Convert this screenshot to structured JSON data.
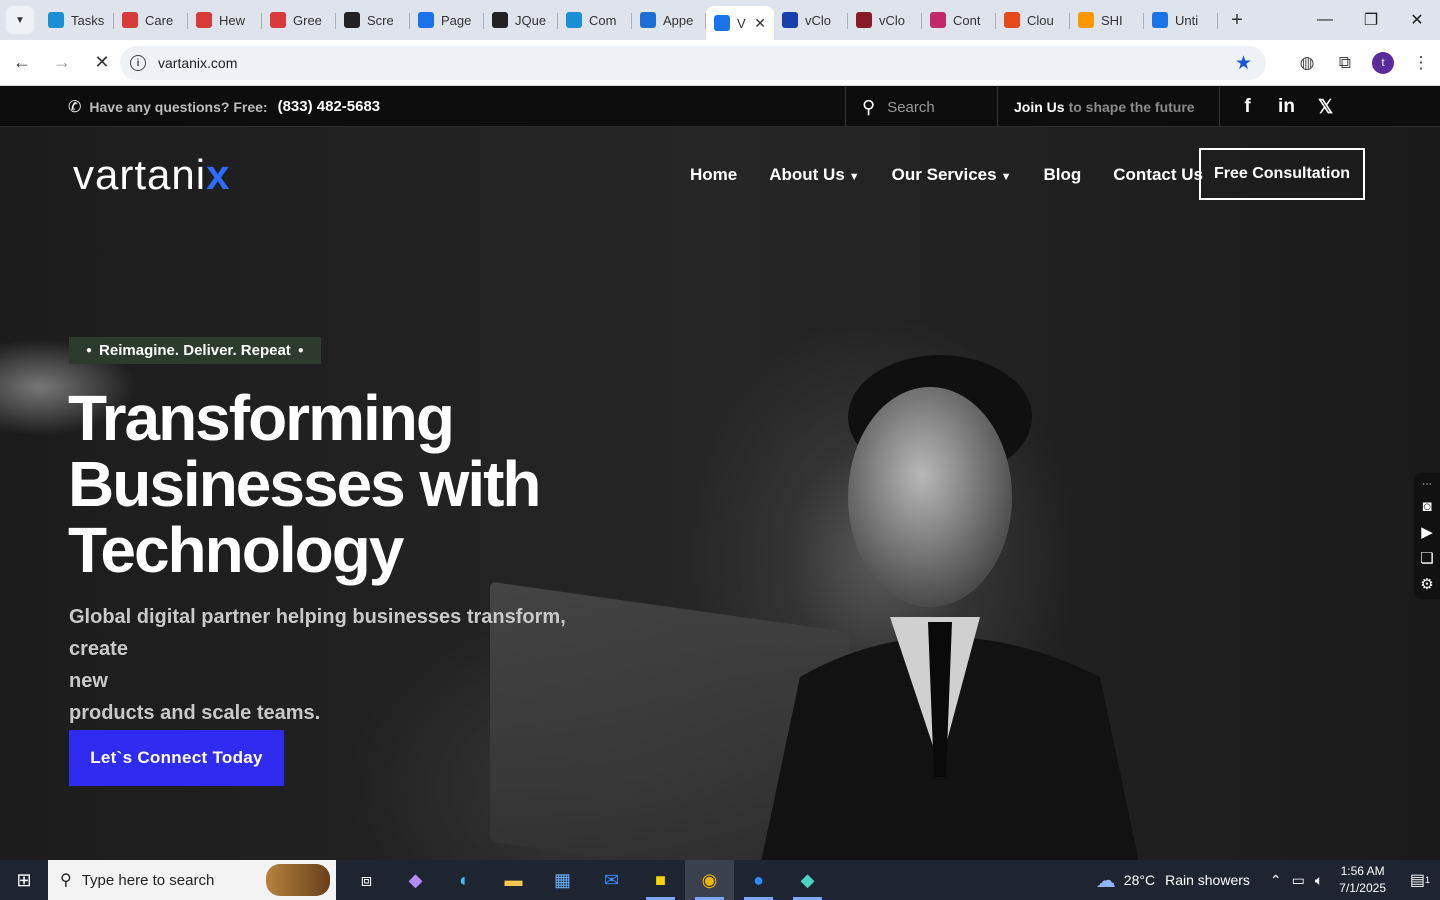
{
  "browser": {
    "tabs": [
      {
        "label": "Tasks",
        "icon": "tasks-icon",
        "color": "#1b8fd6"
      },
      {
        "label": "Care",
        "icon": "care-icon",
        "color": "#d83a3a"
      },
      {
        "label": "Hew",
        "icon": "hew-icon",
        "color": "#d83a3a"
      },
      {
        "label": "Gree",
        "icon": "gree-icon",
        "color": "#d83a3a"
      },
      {
        "label": "Scre",
        "icon": "scre-icon",
        "color": "#222222"
      },
      {
        "label": "Page",
        "icon": "page-icon",
        "color": "#1a73e8"
      },
      {
        "label": "JQue",
        "icon": "jque-icon",
        "color": "#222222"
      },
      {
        "label": "Com",
        "icon": "com-icon",
        "color": "#1b8fd6"
      },
      {
        "label": "Appe",
        "icon": "appe-icon",
        "color": "#1b6fd6"
      },
      {
        "label": "V",
        "icon": "loading-icon",
        "color": "#1a73e8",
        "active": true
      },
      {
        "label": "vClo",
        "icon": "vclo-icon",
        "color": "#1a3fa8"
      },
      {
        "label": "vClo",
        "icon": "vclo2-icon",
        "color": "#8a1a2a"
      },
      {
        "label": "Cont",
        "icon": "cont-icon",
        "color": "#c02a6a"
      },
      {
        "label": "Clou",
        "icon": "clou-icon",
        "color": "#e64a19"
      },
      {
        "label": "SHI",
        "icon": "shi-icon",
        "color": "#ff9800"
      },
      {
        "label": "Unti",
        "icon": "doc-icon",
        "color": "#1a73e8"
      }
    ],
    "url": "vartanix.com",
    "profile_initial": "t"
  },
  "topbar": {
    "question": "Have any questions? Free:",
    "phone": "(833) 482-5683",
    "search_placeholder": "Search",
    "join_bold": "Join Us",
    "join_rest": "to shape the future"
  },
  "nav": {
    "logo_main": "vartani",
    "logo_accent": "x",
    "items": [
      "Home",
      "About Us",
      "Our Services",
      "Blog",
      "Contact Us"
    ],
    "cta": "Free Consultation"
  },
  "hero": {
    "tagline": "Reimagine. Deliver. Repeat",
    "headline_1": "Transforming",
    "headline_2": "Businesses with",
    "headline_3": "Technology",
    "sub_1": "Global digital partner helping businesses transform, create",
    "sub_2": "new",
    "sub_3": "products and scale teams.",
    "button": "Let`s Connect Today"
  },
  "taskbar": {
    "search_placeholder": "Type here to search",
    "weather_temp": "28°C",
    "weather_text": "Rain showers",
    "time": "1:56 AM",
    "date": "7/1/2025",
    "notifications": "1"
  }
}
